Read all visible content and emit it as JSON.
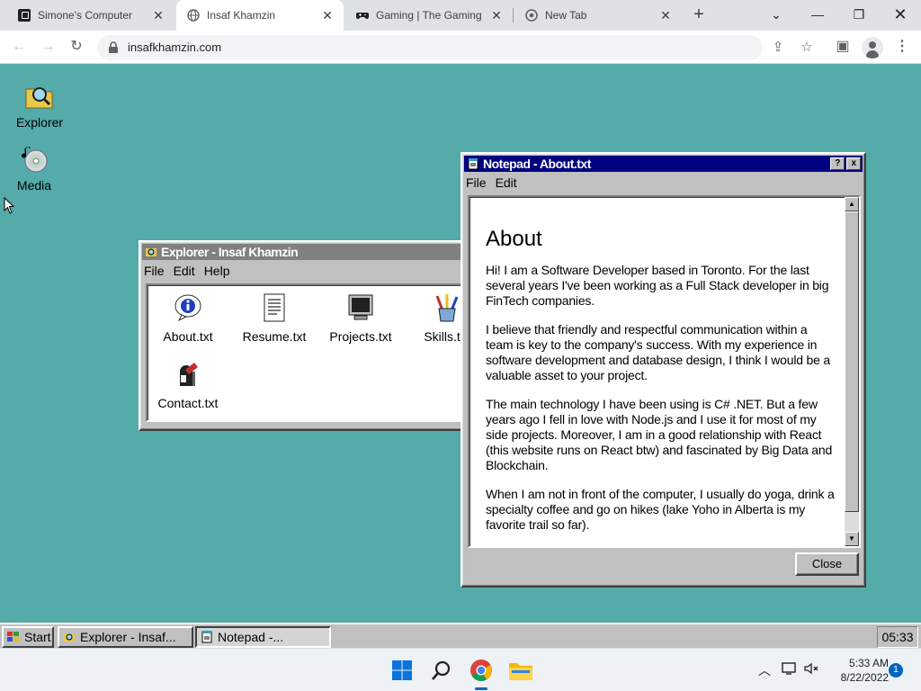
{
  "browser": {
    "tabs": [
      {
        "title": "Simone's Computer",
        "favicon": "dark-square-icon",
        "active": false
      },
      {
        "title": "Insaf Khamzin",
        "favicon": "globe-icon",
        "active": true
      },
      {
        "title": "Gaming | The Gaming",
        "favicon": "gamepad-icon",
        "active": false
      },
      {
        "title": "New Tab",
        "favicon": "chrome-icon",
        "active": false
      }
    ],
    "url": "insafkhamzin.com",
    "new_tab_symbol": "+"
  },
  "desktop": {
    "icons": [
      {
        "label": "Explorer",
        "icon": "folder-magnifier-icon"
      },
      {
        "label": "Media",
        "icon": "cd-music-icon"
      }
    ]
  },
  "explorer": {
    "title": "Explorer - Insaf Khamzin",
    "menu": [
      "File",
      "Edit",
      "Help"
    ],
    "items": [
      {
        "label": "About.txt",
        "icon": "info-icon"
      },
      {
        "label": "Resume.txt",
        "icon": "document-icon"
      },
      {
        "label": "Projects.txt",
        "icon": "monitor-icon"
      },
      {
        "label": "Skills.txt",
        "icon": "pencil-cup-icon"
      },
      {
        "label": "Contact.txt",
        "icon": "mailbox-icon"
      }
    ]
  },
  "notepad": {
    "title": "Notepad - About.txt",
    "help_button": "?",
    "close_x": "x",
    "menu": [
      "File",
      "Edit"
    ],
    "heading": "About",
    "paragraphs": [
      "Hi! I am a Software Developer based in Toronto. For the last several years I've been working as a Full Stack developer in big FinTech companies.",
      "I believe that friendly and respectful communication within a team is key to the company's success. With my experience in software development and database design, I think I would be a valuable asset to your project.",
      "The main technology I have been using is C# .NET. But a few years ago I fell in love with Node.js and I use it for most of my side projects. Moreover, I am in a good relationship with React (this website runs on React btw) and fascinated by Big Data and Blockchain.",
      "When I am not in front of the computer, I usually do yoga, drink a specialty coffee and go on hikes (lake Yoho in Alberta is my favorite trail so far)."
    ],
    "close_button": "Close"
  },
  "taskbar95": {
    "start_label": "Start",
    "tasks": [
      {
        "label": "Explorer - Insaf...",
        "icon": "folder-magnifier-icon",
        "pressed": false
      },
      {
        "label": "Notepad -...",
        "icon": "notepad-icon",
        "pressed": true
      }
    ],
    "clock": "05:33"
  },
  "win11": {
    "time": "5:33 AM",
    "date": "8/22/2022",
    "notification_count": "1"
  },
  "colors": {
    "desktop": "#55aaaa",
    "win95_face": "#c0c0c0",
    "active_title": "#000080",
    "inactive_title": "#808080",
    "accent": "#0067c0"
  }
}
